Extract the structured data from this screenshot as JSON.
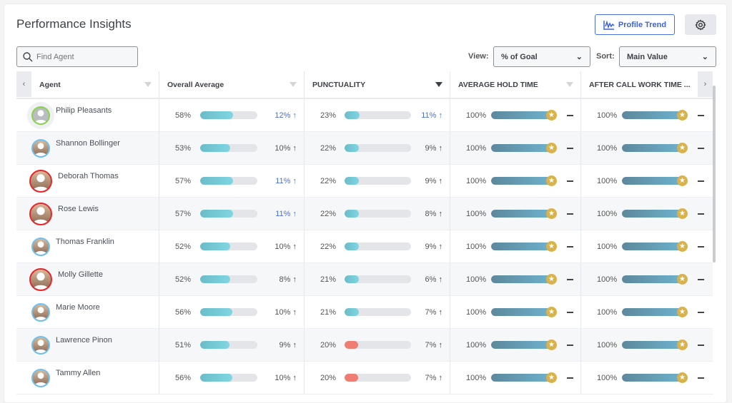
{
  "header": {
    "title": "Performance Insights",
    "profile_trend_label": "Profile Trend"
  },
  "filters": {
    "search_placeholder": "Find Agent",
    "view_label": "View:",
    "view_value": "% of Goal",
    "sort_label": "Sort:",
    "sort_value": "Main Value"
  },
  "columns": [
    {
      "label": "Agent",
      "sorted": false
    },
    {
      "label": "Overall Average",
      "sorted": false
    },
    {
      "label": "PUNCTUALITY",
      "sorted": true
    },
    {
      "label": "AVERAGE HOLD TIME",
      "sorted": false
    },
    {
      "label": "AFTER CALL WORK TIME ...",
      "sorted": false
    }
  ],
  "colors": {
    "accent": "#4a6fdc",
    "teal": "#74cfdc",
    "low": "#ef7d72",
    "hold": "#5d8fa8",
    "star": "#d9b24c"
  },
  "rows": [
    {
      "name": "Philip Pleasants",
      "ring": "#8bd34a",
      "overall": "58%",
      "overall_value": 58,
      "overall_change": "12%",
      "overall_up": true,
      "punct": "23%",
      "punct_value": 23,
      "punct_change": "11%",
      "punct_up": true,
      "hold": "100%",
      "acw": "100%"
    },
    {
      "name": "Shannon Bollinger",
      "ring": "#6ec1ef",
      "overall": "53%",
      "overall_value": 53,
      "overall_change": "10%",
      "overall_up": false,
      "punct": "22%",
      "punct_value": 22,
      "punct_change": "9%",
      "punct_up": false,
      "hold": "100%",
      "acw": "100%"
    },
    {
      "name": "Deborah Thomas",
      "ring": "#e8262a",
      "overall": "57%",
      "overall_value": 57,
      "overall_change": "11%",
      "overall_up": true,
      "punct": "22%",
      "punct_value": 22,
      "punct_change": "9%",
      "punct_up": false,
      "hold": "100%",
      "acw": "100%"
    },
    {
      "name": "Rose Lewis",
      "ring": "#e8262a",
      "overall": "57%",
      "overall_value": 57,
      "overall_change": "11%",
      "overall_up": true,
      "punct": "22%",
      "punct_value": 22,
      "punct_change": "8%",
      "punct_up": false,
      "hold": "100%",
      "acw": "100%"
    },
    {
      "name": "Thomas Franklin",
      "ring": "#6ec1ef",
      "overall": "52%",
      "overall_value": 52,
      "overall_change": "10%",
      "overall_up": false,
      "punct": "22%",
      "punct_value": 22,
      "punct_change": "9%",
      "punct_up": false,
      "hold": "100%",
      "acw": "100%"
    },
    {
      "name": "Molly Gillette",
      "ring": "#e8262a",
      "overall": "52%",
      "overall_value": 52,
      "overall_change": "8%",
      "overall_up": false,
      "punct": "21%",
      "punct_value": 21,
      "punct_change": "6%",
      "punct_up": false,
      "hold": "100%",
      "acw": "100%"
    },
    {
      "name": "Marie Moore",
      "ring": "#6ec1ef",
      "overall": "56%",
      "overall_value": 56,
      "overall_change": "10%",
      "overall_up": false,
      "punct": "21%",
      "punct_value": 21,
      "punct_change": "7%",
      "punct_up": false,
      "hold": "100%",
      "acw": "100%"
    },
    {
      "name": "Lawrence Pinon",
      "ring": "#6ec1ef",
      "overall": "51%",
      "overall_value": 51,
      "overall_change": "9%",
      "overall_up": false,
      "punct": "20%",
      "punct_value": 20,
      "punct_change": "7%",
      "punct_up": false,
      "hold": "100%",
      "acw": "100%"
    },
    {
      "name": "Tammy Allen",
      "ring": "#6ec1ef",
      "overall": "56%",
      "overall_value": 56,
      "overall_change": "10%",
      "overall_up": false,
      "punct": "20%",
      "punct_value": 20,
      "punct_change": "7%",
      "punct_up": false,
      "hold": "100%",
      "acw": "100%"
    }
  ]
}
